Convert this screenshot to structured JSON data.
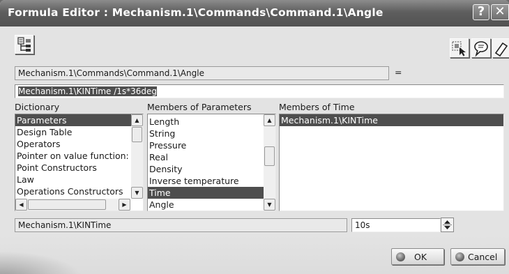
{
  "window": {
    "title": "Formula Editor : Mechanism.1\\Commands\\Command.1\\Angle",
    "help_glyph": "?",
    "close_glyph": "✕"
  },
  "toolbar": {
    "left_icon": "formula-tree-icon",
    "right_icons": [
      "select-parameter-icon",
      "speech-bubble-icon",
      "eraser-icon"
    ]
  },
  "parameter": {
    "path": "Mechanism.1\\Commands\\Command.1\\Angle",
    "equals": "="
  },
  "formula": {
    "value": "Mechanism.1\\KINTime /1s*36deg"
  },
  "dictionary": {
    "label": "Dictionary",
    "items": [
      "Parameters",
      "Design Table",
      "Operators",
      "Pointer on value function:",
      "Point Constructors",
      "Law",
      "Operations Constructors"
    ],
    "selected_index": 0
  },
  "members_of_parameters": {
    "label": "Members of Parameters",
    "items": [
      "Length",
      "String",
      "Pressure",
      "Real",
      "Density",
      "Inverse temperature",
      "Time",
      "Angle"
    ],
    "selected_index": 6
  },
  "members_of_time": {
    "label": "Members of Time",
    "items": [
      "Mechanism.1\\KINTime"
    ],
    "selected_index": 0
  },
  "status": {
    "selected_member": "Mechanism.1\\KINTime",
    "value": "10s"
  },
  "buttons": {
    "ok": "OK",
    "cancel": "Cancel"
  },
  "colors": {
    "title_bar": "#5e5e5e",
    "selection": "#4e4e4e",
    "dialog_bg": "#e3e3e3"
  }
}
